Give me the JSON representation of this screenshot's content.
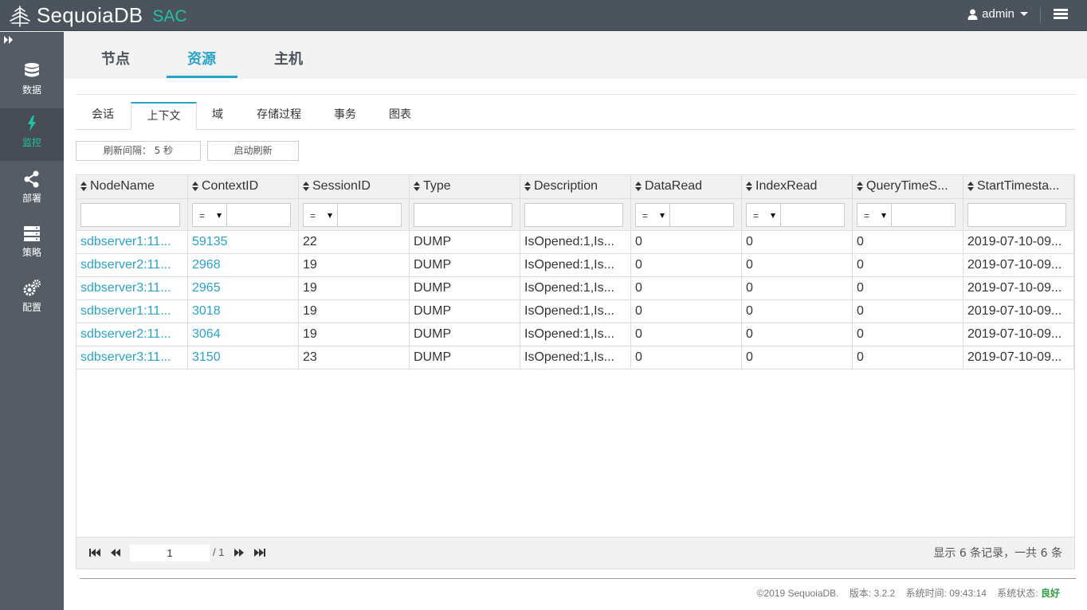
{
  "header": {
    "brand": "SequoiaDB",
    "brand_suffix": "SAC",
    "user": "admin"
  },
  "sidebar": {
    "items": [
      {
        "label": "数据",
        "icon": "database-icon"
      },
      {
        "label": "监控",
        "icon": "lightning-icon",
        "active": true
      },
      {
        "label": "部署",
        "icon": "share-icon"
      },
      {
        "label": "策略",
        "icon": "server-rack-icon"
      },
      {
        "label": "配置",
        "icon": "gears-icon"
      }
    ]
  },
  "nav_tabs": [
    "节点",
    "资源",
    "主机"
  ],
  "nav_active": "资源",
  "sub_tabs": [
    "会话",
    "上下文",
    "域",
    "存储过程",
    "事务",
    "图表"
  ],
  "sub_active": "上下文",
  "toolbar": {
    "interval_label": "刷新间隔： 5 秒",
    "start_label": "启动刷新"
  },
  "table": {
    "columns": [
      "NodeName",
      "ContextID",
      "SessionID",
      "Type",
      "Description",
      "DataRead",
      "IndexRead",
      "QueryTimeS...",
      "StartTimesta..."
    ],
    "operator_default": "=",
    "rows": [
      [
        "sdbserver1:11...",
        "59135",
        "22",
        "DUMP",
        "IsOpened:1,Is...",
        "0",
        "0",
        "0",
        "2019-07-10-09..."
      ],
      [
        "sdbserver2:11...",
        "2968",
        "19",
        "DUMP",
        "IsOpened:1,Is...",
        "0",
        "0",
        "0",
        "2019-07-10-09..."
      ],
      [
        "sdbserver3:11...",
        "2965",
        "19",
        "DUMP",
        "IsOpened:1,Is...",
        "0",
        "0",
        "0",
        "2019-07-10-09..."
      ],
      [
        "sdbserver1:11...",
        "3018",
        "19",
        "DUMP",
        "IsOpened:1,Is...",
        "0",
        "0",
        "0",
        "2019-07-10-09..."
      ],
      [
        "sdbserver2:11...",
        "3064",
        "19",
        "DUMP",
        "IsOpened:1,Is...",
        "0",
        "0",
        "0",
        "2019-07-10-09..."
      ],
      [
        "sdbserver3:11...",
        "3150",
        "23",
        "DUMP",
        "IsOpened:1,Is...",
        "0",
        "0",
        "0",
        "2019-07-10-09..."
      ]
    ]
  },
  "pager": {
    "current_page": "1",
    "total_pages": "/ 1",
    "summary": "显示 6 条记录，一共 6 条"
  },
  "footer": {
    "copyright": "©2019 SequoiaDB.",
    "version": "版本: 3.2.2",
    "system_time": "系统时间: 09:43:14",
    "status_label": "系统状态:",
    "status_value": "良好"
  },
  "colors": {
    "accent": "#2aa3c8",
    "brand_green": "#1ec3a6",
    "topbar": "#4b545c",
    "sidebar": "#565c66",
    "status_good": "#2e9e3f"
  }
}
